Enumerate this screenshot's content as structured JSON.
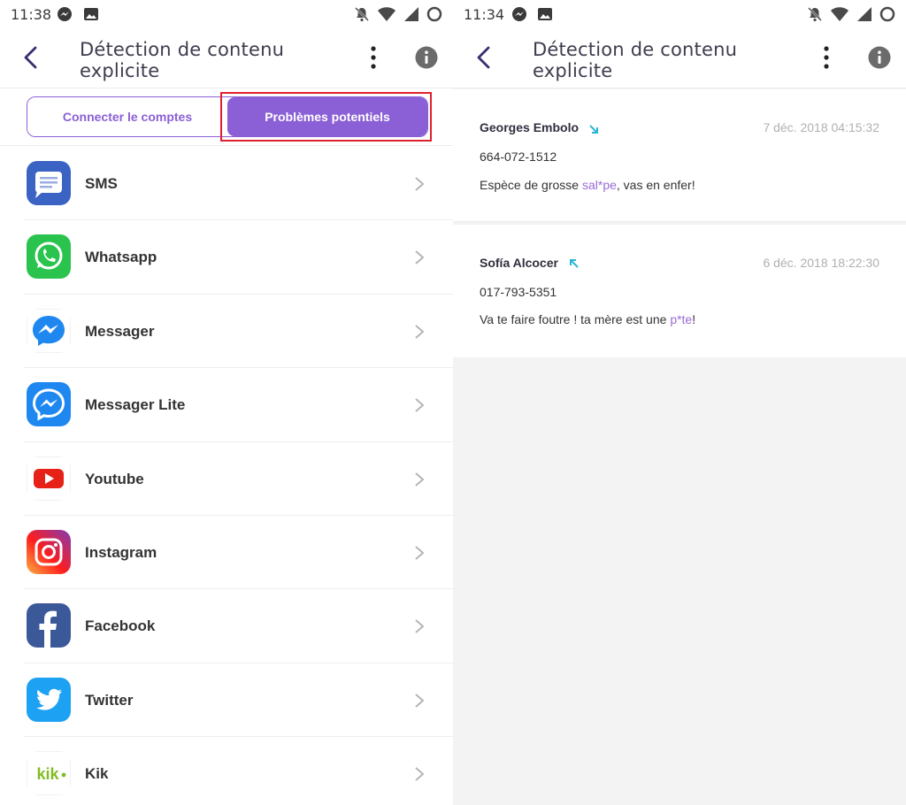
{
  "left": {
    "status": {
      "time": "11:38"
    },
    "appbar": {
      "title": "Détection de contenu explicite"
    },
    "tabs": [
      {
        "label": "Connecter le comptes",
        "active": false
      },
      {
        "label": "Problèmes potentiels",
        "active": true
      }
    ],
    "apps": [
      {
        "name": "SMS",
        "icon": "sms-icon"
      },
      {
        "name": "Whatsapp",
        "icon": "whatsapp-icon"
      },
      {
        "name": "Messager",
        "icon": "messenger-icon"
      },
      {
        "name": "Messager Lite",
        "icon": "messenger-lite-icon"
      },
      {
        "name": "Youtube",
        "icon": "youtube-icon"
      },
      {
        "name": "Instagram",
        "icon": "instagram-icon"
      },
      {
        "name": "Facebook",
        "icon": "facebook-icon"
      },
      {
        "name": "Twitter",
        "icon": "twitter-icon"
      },
      {
        "name": "Kik",
        "icon": "kik-icon"
      }
    ]
  },
  "right": {
    "status": {
      "time": "11:34"
    },
    "appbar": {
      "title": "Détection de contenu explicite"
    },
    "messages": [
      {
        "sender": "Georges Embolo",
        "direction": "incoming",
        "timestamp": "7 déc. 2018 04:15:32",
        "phone": "664-072-1512",
        "text_before": "Espèce de grosse ",
        "flagged": "sal*pe",
        "text_after": ", vas en enfer!"
      },
      {
        "sender": "Sofía Alcocer",
        "direction": "outgoing",
        "timestamp": "6 déc. 2018 18:22:30",
        "phone": "017-793-5351",
        "text_before": "Va te faire foutre ! ta mère est une ",
        "flagged": "p*te",
        "text_after": "!"
      }
    ]
  },
  "colors": {
    "accent": "#8b5fd6",
    "highlight": "#e0212d",
    "arrow": "#29b6d6"
  }
}
